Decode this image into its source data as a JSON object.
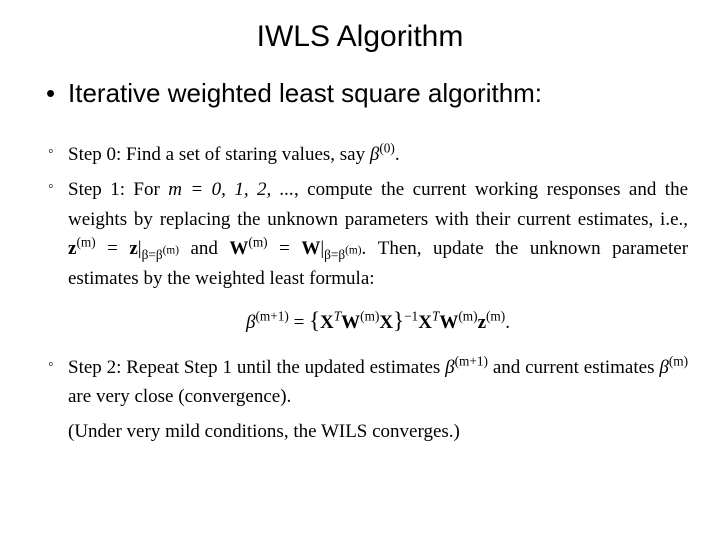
{
  "title": "IWLS Algorithm",
  "main_bullet": "Iterative weighted least square algorithm:",
  "steps": {
    "s0_prefix": "Step 0: Find a set of staring values, say ",
    "s0_sym_base": "β",
    "s0_sym_sup": "(0)",
    "s0_suffix": ".",
    "s1_intro_a": "Step 1: For ",
    "s1_mrange": "m = 0, 1, 2, ...",
    "s1_intro_b": ", compute the current working responses and the weights by replacing the unknown parameters with their current estimates, i.e., ",
    "s1_zm": "z",
    "s1_zm_sup": "(m)",
    "s1_eq1": " = ",
    "s1_zbar": "z",
    "s1_bar": "|",
    "s1_sub1": "β=β",
    "s1_sub1_sup": "(m)",
    "s1_and": " and ",
    "s1_Wm": "W",
    "s1_Wm_sup": "(m)",
    "s1_eq2": " = ",
    "s1_Wbar": "W",
    "s1_sub2": "β=β",
    "s1_sub2_sup": "(m)",
    "s1_after": ". Then, update the unknown parameter estimates by the weighted least formula:",
    "formula_beta": "β",
    "formula_beta_sup": "(m+1)",
    "formula_eq": " = ",
    "formula_lbrace": "{",
    "formula_XT": "X",
    "formula_T": "T",
    "formula_W": "W",
    "formula_Wsup": "(m)",
    "formula_X": "X",
    "formula_rbrace": "}",
    "formula_neg1": "−1",
    "formula_XT2": "X",
    "formula_T2": "T",
    "formula_W2": "W",
    "formula_W2sup": "(m)",
    "formula_z": "z",
    "formula_zsup": "(m)",
    "formula_period": ".",
    "s2_a": "Step 2: Repeat Step 1 until the updated estimates ",
    "s2_beta1": "β",
    "s2_beta1_sup": "(m+1)",
    "s2_b": " and current estimates ",
    "s2_beta2": "β",
    "s2_beta2_sup": "(m)",
    "s2_c": " are very close (convergence).",
    "note": "(Under very mild conditions, the WILS converges.)"
  }
}
